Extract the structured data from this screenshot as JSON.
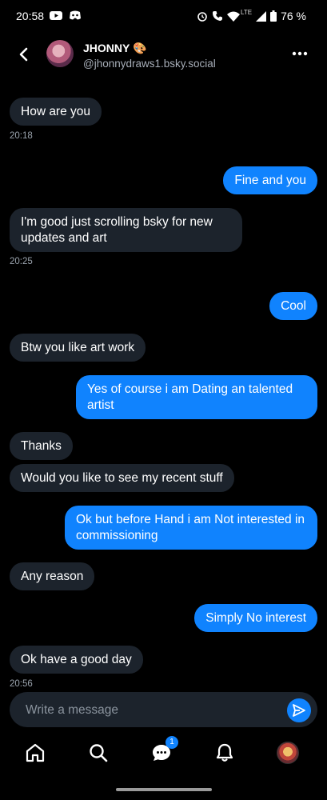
{
  "status_bar": {
    "time": "20:58",
    "network": "LTE",
    "battery": "76 %"
  },
  "header": {
    "name": "JHONNY 🎨",
    "handle": "@jhonnydraws1.bsky.social"
  },
  "messages": [
    {
      "text": "How are you",
      "time": "20:18"
    },
    {
      "text": "Fine and you"
    },
    {
      "text": "I'm good just scrolling bsky for new updates and art",
      "time": "20:25"
    },
    {
      "text": "Cool"
    },
    {
      "text": "Btw you like art work"
    },
    {
      "text": "Yes of course i am Dating an talented artist"
    },
    {
      "text": "Thanks"
    },
    {
      "text": "Would you like to see my recent stuff"
    },
    {
      "text": "Ok but before Hand i am Not interested in commissioning"
    },
    {
      "text": "Any reason"
    },
    {
      "text": "Simply No interest"
    },
    {
      "text": "Ok have a good day",
      "time": "20:56"
    }
  ],
  "composer": {
    "placeholder": "Write a message"
  },
  "tabs": {
    "chat_badge": "1"
  },
  "colors": {
    "accent": "#1083fe",
    "received_bubble": "#1c232c",
    "background": "#000000"
  }
}
